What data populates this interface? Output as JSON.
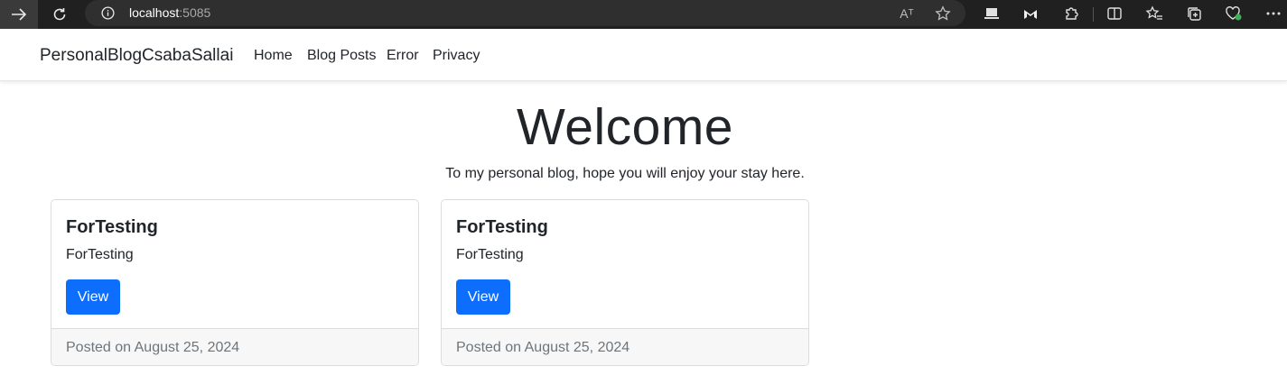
{
  "browser": {
    "url_host": "localhost",
    "url_port": ":5085",
    "icons": [
      "forward-arrow-icon",
      "reload-icon",
      "info-icon",
      "read-aloud-icon",
      "favorite-star-icon",
      "screen-icon",
      "malwarebytes-icon",
      "extensions-icon",
      "split-screen-icon",
      "favorites-icon",
      "collections-icon",
      "browser-essentials-icon",
      "more-icon"
    ],
    "read_aloud_glyph": "Aᵀ"
  },
  "navbar": {
    "brand": "PersonalBlogCsabaSallai",
    "links": [
      "Home",
      "Blog Posts",
      "Error",
      "Privacy"
    ]
  },
  "hero": {
    "title": "Welcome",
    "subtitle": "To my personal blog, hope you will enjoy your stay here."
  },
  "posts": [
    {
      "title": "ForTesting",
      "text": "ForTesting",
      "button": "View",
      "footer": "Posted on August 25, 2024"
    },
    {
      "title": "ForTesting",
      "text": "ForTesting",
      "button": "View",
      "footer": "Posted on August 25, 2024"
    }
  ],
  "colors": {
    "primary": "#0d6efd",
    "chrome_bg": "#202020",
    "muted": "#6c757d"
  }
}
